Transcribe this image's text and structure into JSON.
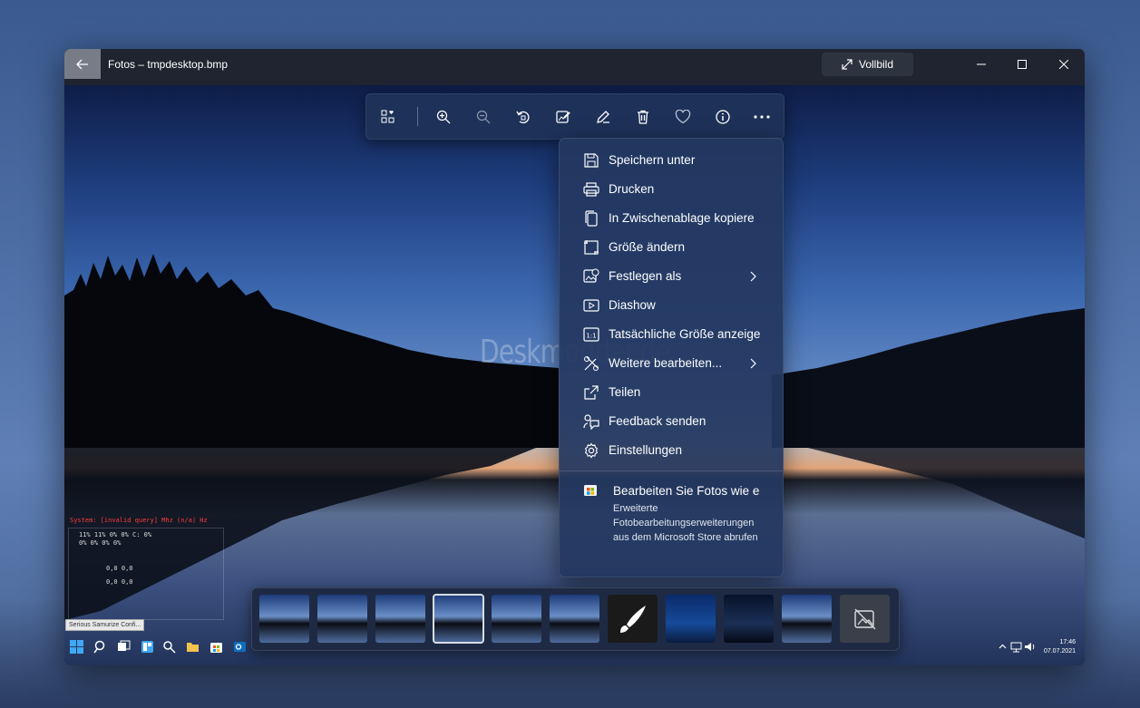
{
  "window": {
    "title": "Fotos – tmpdesktop.bmp",
    "fullscreen_label": "Vollbild"
  },
  "toolbar": {
    "buttons": [
      "collection-icon",
      "zoom-in-icon",
      "zoom-out-icon",
      "rotate-icon",
      "edit-image-icon",
      "draw-icon",
      "delete-icon",
      "favorite-icon",
      "info-icon",
      "more-icon"
    ]
  },
  "menu": {
    "items": [
      {
        "label": "Speichern unter",
        "icon": "save-icon"
      },
      {
        "label": "Drucken",
        "icon": "print-icon"
      },
      {
        "label": "In Zwischenablage kopiere",
        "icon": "copy-icon"
      },
      {
        "label": "Größe ändern",
        "icon": "resize-icon"
      },
      {
        "label": "Festlegen als",
        "icon": "set-as-icon",
        "submenu": true
      },
      {
        "label": "Diashow",
        "icon": "slideshow-icon"
      },
      {
        "label": "Tatsächliche Größe anzeige",
        "icon": "actual-size-icon"
      },
      {
        "label": "Weitere bearbeiten...",
        "icon": "edit-more-icon",
        "submenu": true
      },
      {
        "label": "Teilen",
        "icon": "share-icon"
      },
      {
        "label": "Feedback senden",
        "icon": "feedback-icon"
      },
      {
        "label": "Einstellungen",
        "icon": "settings-icon"
      }
    ],
    "promo": {
      "title": "Bearbeiten Sie Fotos wie e",
      "description": "Erweiterte Fotobearbeitungserweiterungen aus dem Microsoft Store abrufen"
    }
  },
  "watermark": "Deskmodder.de",
  "widget": {
    "row1": "System:   [invalid query] Mhz   (n/a) Hz",
    "row2": "11%     11%     0%      0%     C: 0%",
    "row3": "0%      0%      0%      0%",
    "row4": "0,0             0,0",
    "row5": "0,0             0,0",
    "tooltip": "Serious Samurize Confi..."
  },
  "taskbar": {
    "time": "17:46",
    "date": "07.07.2021"
  },
  "colors": {
    "accent": "#1e3158",
    "menu_bg": "#233860",
    "titlebar": "#1f2430"
  }
}
